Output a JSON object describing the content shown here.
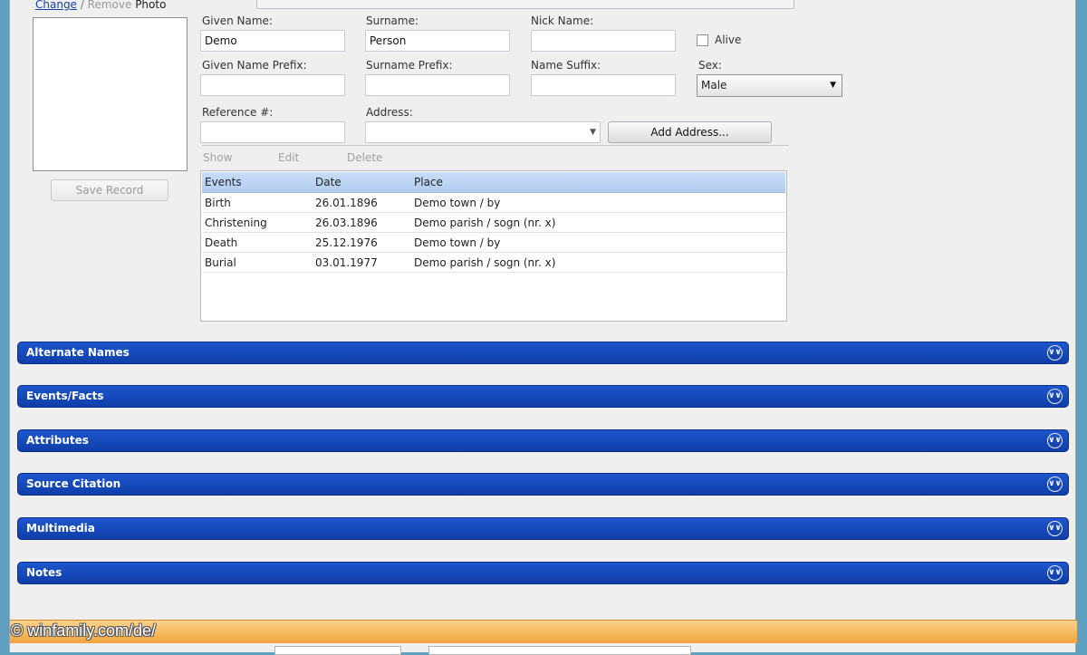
{
  "photo": {
    "change_label": "Change",
    "separator": "/",
    "remove_label": "Remove",
    "photo_label": "Photo",
    "save_record_label": "Save Record"
  },
  "form": {
    "given_name": {
      "label": "Given Name:",
      "value": "Demo"
    },
    "surname": {
      "label": "Surname:",
      "value": "Person"
    },
    "nick_name": {
      "label": "Nick Name:",
      "value": ""
    },
    "alive_label": "Alive",
    "given_name_prefix": {
      "label": "Given Name Prefix:",
      "value": ""
    },
    "surname_prefix": {
      "label": "Surname Prefix:",
      "value": ""
    },
    "name_suffix": {
      "label": "Name Suffix:",
      "value": ""
    },
    "sex": {
      "label": "Sex:",
      "value": "Male"
    },
    "reference": {
      "label": "Reference #:",
      "value": ""
    },
    "address": {
      "label": "Address:",
      "value": ""
    },
    "add_address_label": "Add Address..."
  },
  "events_toolbar": {
    "show": "Show",
    "edit": "Edit",
    "delete": "Delete"
  },
  "events_table": {
    "columns": [
      "Events",
      "Date",
      "Place"
    ],
    "rows": [
      [
        "Birth",
        "26.01.1896",
        "Demo town / by"
      ],
      [
        "Christening",
        "26.03.1896",
        "Demo parish / sogn (nr. x)"
      ],
      [
        "Death",
        "25.12.1976",
        "Demo town / by"
      ],
      [
        "Burial",
        "03.01.1977",
        "Demo parish / sogn (nr. x)"
      ]
    ]
  },
  "sections": [
    "Alternate Names",
    "Events/Facts",
    "Attributes",
    "Source Citation",
    "Multimedia",
    "Notes"
  ],
  "watermark": "© winfamily.com/de/",
  "icons": {
    "expand": "double-chevron-down-icon",
    "dropdown": "dropdown-arrow-icon"
  },
  "colors": {
    "section_bar": "#1a4fc4",
    "header_row": "#c1d6f3",
    "status_bar": "#f5b14f"
  }
}
